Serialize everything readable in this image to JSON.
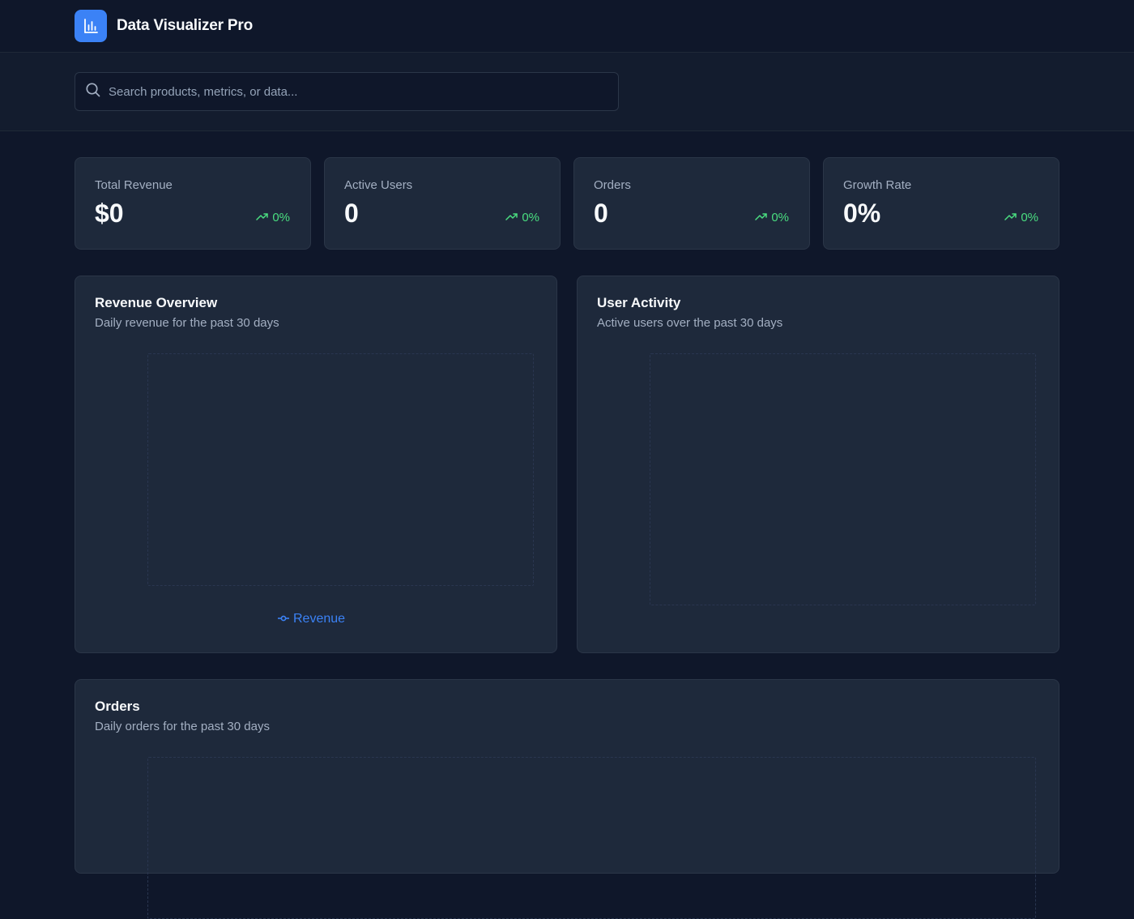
{
  "header": {
    "app_title": "Data Visualizer Pro",
    "logo_icon": "bar-chart-icon",
    "accent_color": "#3b82f6"
  },
  "search": {
    "placeholder": "Search products, metrics, or data...",
    "value": ""
  },
  "stats": [
    {
      "label": "Total Revenue",
      "value": "$0",
      "change": "0%"
    },
    {
      "label": "Active Users",
      "value": "0",
      "change": "0%"
    },
    {
      "label": "Orders",
      "value": "0",
      "change": "0%"
    },
    {
      "label": "Growth Rate",
      "value": "0%",
      "change": "0%"
    }
  ],
  "panels": {
    "revenue": {
      "title": "Revenue Overview",
      "subtitle": "Daily revenue for the past 30 days",
      "legend": "Revenue"
    },
    "users": {
      "title": "User Activity",
      "subtitle": "Active users over the past 30 days"
    },
    "orders": {
      "title": "Orders",
      "subtitle": "Daily orders for the past 30 days"
    }
  },
  "colors": {
    "positive": "#4ade80",
    "background": "#0f172a",
    "card": "#1e293b"
  }
}
